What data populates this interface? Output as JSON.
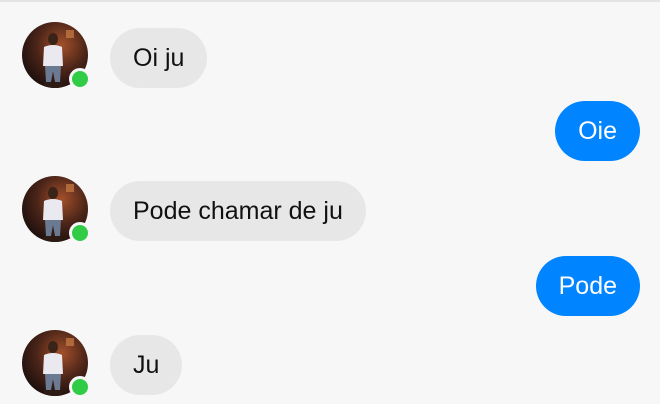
{
  "conversation": {
    "messages": [
      {
        "text": "Oi ju",
        "sender": "contact"
      },
      {
        "text": "Oie",
        "sender": "me"
      },
      {
        "text": "Pode chamar de ju",
        "sender": "contact"
      },
      {
        "text": "Pode",
        "sender": "me"
      },
      {
        "text": "Ju",
        "sender": "contact"
      }
    ],
    "contact_status": "online"
  },
  "colors": {
    "incoming_bubble": "#e7e7e7",
    "outgoing_bubble": "#0084ff",
    "online_indicator": "#31cc46",
    "background": "#f7f7f7"
  },
  "icons": {
    "presence": "online-dot-icon"
  }
}
